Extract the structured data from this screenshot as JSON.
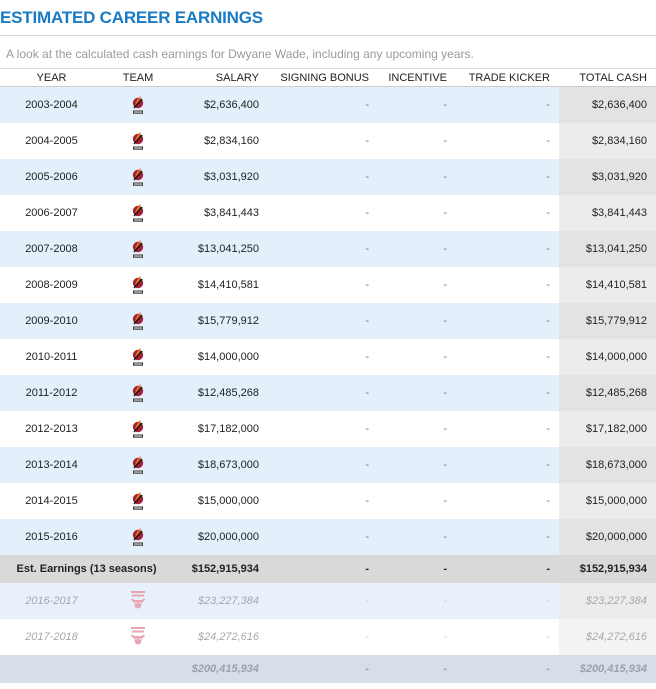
{
  "title": "ESTIMATED CAREER EARNINGS",
  "subtitle": "A look at the calculated cash earnings for Dwyane Wade, including any upcoming years.",
  "columns": [
    "YEAR",
    "TEAM",
    "SALARY",
    "SIGNING BONUS",
    "INCENTIVE",
    "TRADE KICKER",
    "TOTAL CASH"
  ],
  "colors": {
    "heading": "#1a7bc4",
    "heat_red": "#a3203a",
    "bulls_pink": "#e8a5b3"
  },
  "rows": [
    {
      "year": "2003-2004",
      "team_icon": "miami-heat-logo-icon",
      "salary": "$2,636,400",
      "bonus": "-",
      "incentive": "-",
      "kicker": "-",
      "total": "$2,636,400"
    },
    {
      "year": "2004-2005",
      "team_icon": "miami-heat-logo-icon",
      "salary": "$2,834,160",
      "bonus": "-",
      "incentive": "-",
      "kicker": "-",
      "total": "$2,834,160"
    },
    {
      "year": "2005-2006",
      "team_icon": "miami-heat-logo-icon",
      "salary": "$3,031,920",
      "bonus": "-",
      "incentive": "-",
      "kicker": "-",
      "total": "$3,031,920"
    },
    {
      "year": "2006-2007",
      "team_icon": "miami-heat-logo-icon",
      "salary": "$3,841,443",
      "bonus": "-",
      "incentive": "-",
      "kicker": "-",
      "total": "$3,841,443"
    },
    {
      "year": "2007-2008",
      "team_icon": "miami-heat-logo-icon",
      "salary": "$13,041,250",
      "bonus": "-",
      "incentive": "-",
      "kicker": "-",
      "total": "$13,041,250"
    },
    {
      "year": "2008-2009",
      "team_icon": "miami-heat-logo-icon",
      "salary": "$14,410,581",
      "bonus": "-",
      "incentive": "-",
      "kicker": "-",
      "total": "$14,410,581"
    },
    {
      "year": "2009-2010",
      "team_icon": "miami-heat-logo-icon",
      "salary": "$15,779,912",
      "bonus": "-",
      "incentive": "-",
      "kicker": "-",
      "total": "$15,779,912"
    },
    {
      "year": "2010-2011",
      "team_icon": "miami-heat-logo-icon",
      "salary": "$14,000,000",
      "bonus": "-",
      "incentive": "-",
      "kicker": "-",
      "total": "$14,000,000"
    },
    {
      "year": "2011-2012",
      "team_icon": "miami-heat-logo-icon",
      "salary": "$12,485,268",
      "bonus": "-",
      "incentive": "-",
      "kicker": "-",
      "total": "$12,485,268"
    },
    {
      "year": "2012-2013",
      "team_icon": "miami-heat-logo-icon",
      "salary": "$17,182,000",
      "bonus": "-",
      "incentive": "-",
      "kicker": "-",
      "total": "$17,182,000"
    },
    {
      "year": "2013-2014",
      "team_icon": "miami-heat-logo-icon",
      "salary": "$18,673,000",
      "bonus": "-",
      "incentive": "-",
      "kicker": "-",
      "total": "$18,673,000"
    },
    {
      "year": "2014-2015",
      "team_icon": "miami-heat-logo-icon",
      "salary": "$15,000,000",
      "bonus": "-",
      "incentive": "-",
      "kicker": "-",
      "total": "$15,000,000"
    },
    {
      "year": "2015-2016",
      "team_icon": "miami-heat-logo-icon",
      "salary": "$20,000,000",
      "bonus": "-",
      "incentive": "-",
      "kicker": "-",
      "total": "$20,000,000"
    }
  ],
  "summary": {
    "label": "Est. Earnings (13 seasons)",
    "salary": "$152,915,934",
    "bonus": "-",
    "incentive": "-",
    "kicker": "-",
    "total": "$152,915,934"
  },
  "future_rows": [
    {
      "year": "2016-2017",
      "team_icon": "chicago-bulls-logo-icon",
      "salary": "$23,227,384",
      "bonus": "-",
      "incentive": "-",
      "kicker": "-",
      "total": "$23,227,384"
    },
    {
      "year": "2017-2018",
      "team_icon": "chicago-bulls-logo-icon",
      "salary": "$24,272,616",
      "bonus": "-",
      "incentive": "-",
      "kicker": "-",
      "total": "$24,272,616"
    }
  ],
  "projected": {
    "label": "",
    "salary": "$200,415,934",
    "bonus": "-",
    "incentive": "-",
    "kicker": "-",
    "total": "$200,415,934"
  }
}
